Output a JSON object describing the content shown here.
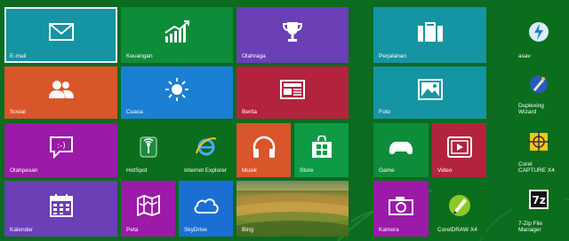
{
  "screen": {
    "background_color": "#0b6b1f",
    "accent_outline": "#e8f1ea"
  },
  "tiles": {
    "email": {
      "label": "E-mail",
      "color": "#1594a3",
      "icon": "mail-icon"
    },
    "finance": {
      "label": "Keuangan",
      "color": "#0d8c3a",
      "icon": "chart-icon"
    },
    "sports": {
      "label": "Olahraga",
      "color": "#6b3fb6",
      "icon": "trophy-icon"
    },
    "travel": {
      "label": "Perjalanan",
      "color": "#1594a3",
      "icon": "suitcase-icon"
    },
    "asav": {
      "label": "asav",
      "color": "#0b6e1d",
      "icon": "asav-icon"
    },
    "social": {
      "label": "Sosial",
      "color": "#d9552a",
      "icon": "people-icon"
    },
    "weather": {
      "label": "Cuaca",
      "color": "#1b7fd3",
      "icon": "sun-icon"
    },
    "news": {
      "label": "Berita",
      "color": "#b3233e",
      "icon": "newspaper-icon"
    },
    "photos": {
      "label": "Foto",
      "color": "#1594a3",
      "icon": "photo-icon"
    },
    "duplexing": {
      "label": "Duplexing Wizard",
      "color": "#0b6e1d",
      "icon": "wizard-icon"
    },
    "messaging": {
      "label": "Olahpesan",
      "color": "#9b1aa8",
      "icon": "chat-icon"
    },
    "hotspot": {
      "label": "HotSpot",
      "color": "#0b6e1d",
      "icon": "hotspot-icon"
    },
    "ie": {
      "label": "Internet Explorer",
      "color": "#0b6e1d",
      "icon": "ie-icon"
    },
    "music": {
      "label": "Musik",
      "color": "#d9552a",
      "icon": "headphones-icon"
    },
    "store": {
      "label": "Store",
      "color": "#0d9b45",
      "icon": "store-icon"
    },
    "games": {
      "label": "Game",
      "color": "#0d8c3a",
      "icon": "gamepad-icon"
    },
    "video": {
      "label": "Video",
      "color": "#b3233e",
      "icon": "video-icon"
    },
    "corelcap": {
      "label": "Corel CAPTURE X4",
      "color": "#0b6e1d",
      "icon": "corel-capture-icon"
    },
    "calendar": {
      "label": "Kalender",
      "color": "#6b3fb6",
      "icon": "calendar-icon"
    },
    "maps": {
      "label": "Peta",
      "color": "#9b1aa8",
      "icon": "map-icon"
    },
    "skydrive": {
      "label": "SkyDrive",
      "color": "#1b6fd3",
      "icon": "cloud-icon"
    },
    "bing": {
      "label": "Bing",
      "color": "#8a7a30",
      "icon": "landscape-photo"
    },
    "camera": {
      "label": "Kamera",
      "color": "#9b1aa8",
      "icon": "camera-icon"
    },
    "coreldraw": {
      "label": "CorelDRAW X4",
      "color": "#0b6e1d",
      "icon": "coreldraw-icon"
    },
    "zip": {
      "label": "7-Zip File Manager",
      "color": "#0b6e1d",
      "icon": "7zip-icon"
    }
  }
}
